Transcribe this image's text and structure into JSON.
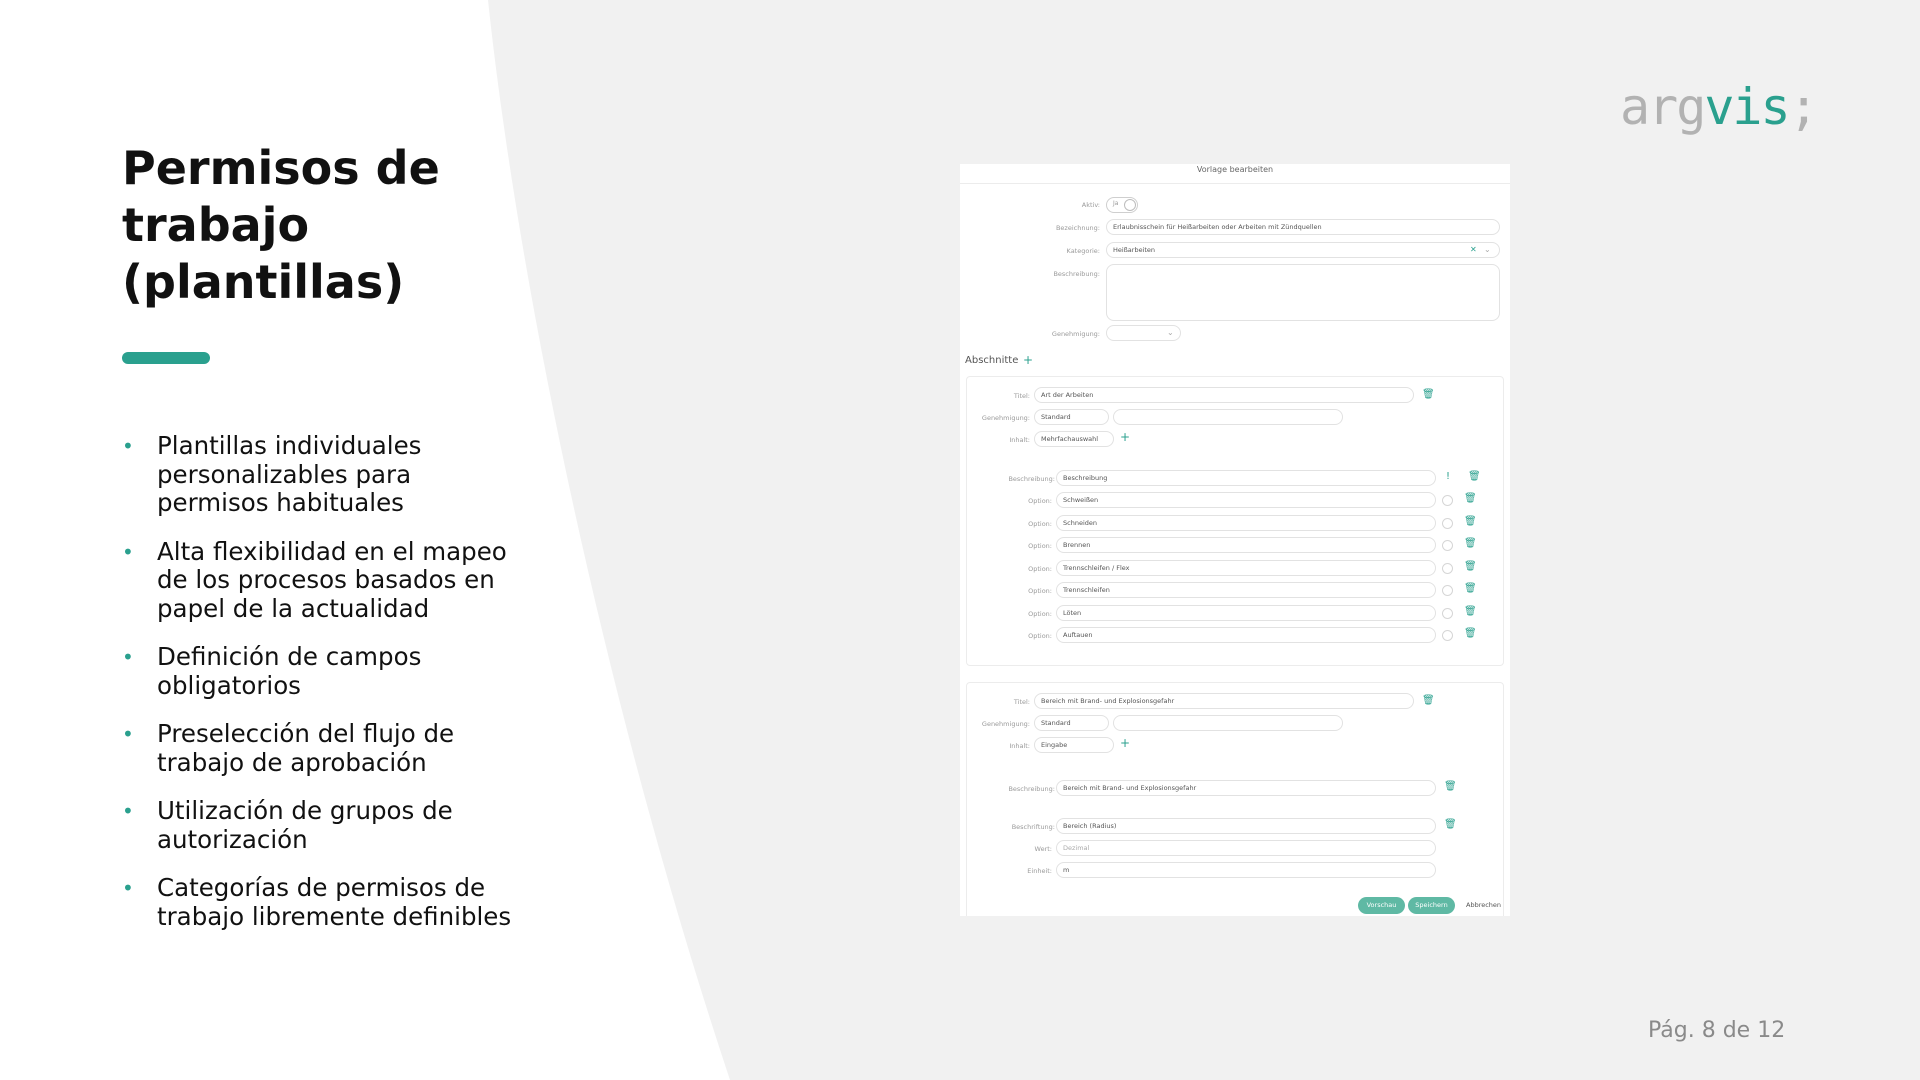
{
  "slide": {
    "title": "Permisos de trabajo (plantillas)",
    "bullets": [
      "Plantillas individuales personalizables para permisos habituales",
      "Alta flexibilidad en el mapeo de los procesos basados en papel de la actualidad",
      "Definición de campos obligatorios",
      "Preselección del flujo de trabajo de aprobación",
      "Utilización de grupos de autorización",
      "Categorías de permisos de trabajo libremente definibles"
    ],
    "page_number": "Pág. 8 de 12"
  },
  "logo": {
    "part1": "arg",
    "part2": "vis",
    "part3": ";"
  },
  "colors": {
    "accent": "#2aa08e",
    "button": "#5fb9a4",
    "logo_gray": "#b2b2b2",
    "background": "#f1f1f1"
  },
  "screenshot": {
    "header": "Vorlage bearbeiten",
    "form": {
      "aktiv_label": "Aktiv:",
      "toggle_text": "Ja",
      "bezeichnung_label": "Bezeichnung:",
      "bezeichnung_value": "Erlaubnisschein für Heißarbeiten oder Arbeiten mit Zündquellen",
      "kategorie_label": "Kategorie:",
      "kategorie_value": "Heißarbeiten",
      "beschreibung_label": "Beschreibung:",
      "genehmigung_label": "Genehmigung:"
    },
    "abschnitte_label": "Abschnitte",
    "section1": {
      "titel_label": "Titel:",
      "titel_value": "Art der Arbeiten",
      "genehmigung_label": "Genehmigung:",
      "genehmigung_value": "Standard",
      "inhalt_label": "Inhalt:",
      "inhalt_value": "Mehrfachauswahl",
      "beschreibung_label": "Beschreibung:",
      "beschreibung_value": "Beschreibung",
      "option_label": "Option:",
      "options": [
        "Schweißen",
        "Schneiden",
        "Brennen",
        "Trennschleifen / Flex",
        "Trennschleifen",
        "Löten",
        "Auftauen"
      ]
    },
    "section2": {
      "titel_label": "Titel:",
      "titel_value": "Bereich mit Brand- und Explosionsgefahr",
      "genehmigung_label": "Genehmigung:",
      "genehmigung_value": "Standard",
      "inhalt_label": "Inhalt:",
      "inhalt_value": "Eingabe",
      "beschreibung_label": "Beschreibung:",
      "beschreibung_value": "Bereich mit Brand- und Explosionsgefahr",
      "beschriftung_label": "Beschriftung:",
      "beschriftung_value": "Bereich (Radius)",
      "wert_label": "Wert:",
      "wert_placeholder": "Dezimal",
      "einheit_label": "Einheit:",
      "einheit_value": "m"
    },
    "buttons": {
      "vorschau": "Vorschau",
      "speichern": "Speichern",
      "abbrechen": "Abbrechen"
    }
  }
}
